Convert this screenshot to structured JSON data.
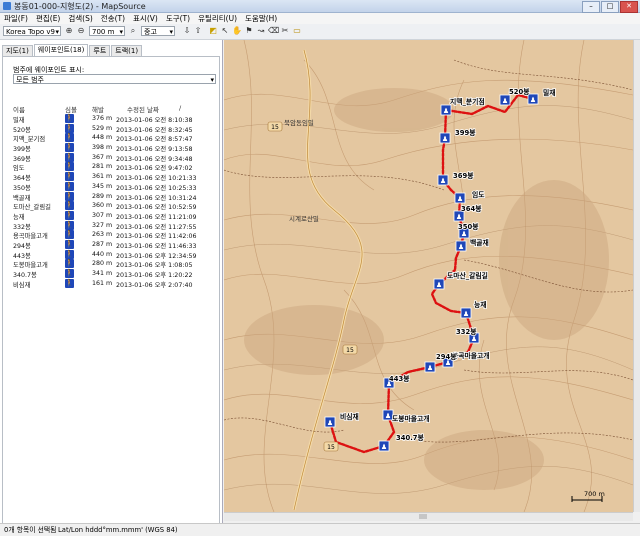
{
  "window": {
    "title": "봉동01-000-지형도(2) - MapSource"
  },
  "menu": [
    "파일(F)",
    "편집(E)",
    "검색(S)",
    "전송(T)",
    "표시(V)",
    "도구(T)",
    "유틸리티(U)",
    "도움말(H)"
  ],
  "toolbar": {
    "map_product": "Korea Topo v9",
    "zoom_level": "700 m",
    "detail": "중고"
  },
  "tabs": [
    "지도(1)",
    "웨이포인트(18)",
    "루트",
    "트랙(1)"
  ],
  "filter": {
    "label": "범주에 웨이포인트 표시:",
    "value": "모든 범주"
  },
  "table": {
    "headers": {
      "name": "이름",
      "symbol": "심볼",
      "altitude": "해발",
      "modified": "수정된 날짜"
    },
    "rows": [
      {
        "name": "밀재",
        "alt": "376 m",
        "date": "2013-01-06 오전 8:10:38"
      },
      {
        "name": "520봉",
        "alt": "529 m",
        "date": "2013-01-06 오전 8:32:45"
      },
      {
        "name": "지맥_분기점",
        "alt": "448 m",
        "date": "2013-01-06 오전 8:57:47"
      },
      {
        "name": "399봉",
        "alt": "398 m",
        "date": "2013-01-06 오전 9:13:58"
      },
      {
        "name": "369봉",
        "alt": "367 m",
        "date": "2013-01-06 오전 9:34:48"
      },
      {
        "name": "임도",
        "alt": "281 m",
        "date": "2013-01-06 오전 9:47:02"
      },
      {
        "name": "364봉",
        "alt": "361 m",
        "date": "2013-01-06 오전 10:21:33"
      },
      {
        "name": "350봉",
        "alt": "345 m",
        "date": "2013-01-06 오전 10:25:33"
      },
      {
        "name": "백골재",
        "alt": "289 m",
        "date": "2013-01-06 오전 10:31:24"
      },
      {
        "name": "도마산_갈림길",
        "alt": "360 m",
        "date": "2013-01-06 오전 10:52:59"
      },
      {
        "name": "능재",
        "alt": "307 m",
        "date": "2013-01-06 오전 11:21:09"
      },
      {
        "name": "332봉",
        "alt": "327 m",
        "date": "2013-01-06 오전 11:27:55"
      },
      {
        "name": "용곡마을고개",
        "alt": "263 m",
        "date": "2013-01-06 오전 11:42:06"
      },
      {
        "name": "294봉",
        "alt": "287 m",
        "date": "2013-01-06 오전 11:46:33"
      },
      {
        "name": "443봉",
        "alt": "440 m",
        "date": "2013-01-06 오후 12:34:59"
      },
      {
        "name": "도봉마을고개",
        "alt": "280 m",
        "date": "2013-01-06 오후 1:08:05"
      },
      {
        "name": "340.7봉",
        "alt": "341 m",
        "date": "2013-01-06 오후 1:20:22"
      },
      {
        "name": "비심재",
        "alt": "161 m",
        "date": "2013-01-06 오후 2:07:40"
      }
    ]
  },
  "map": {
    "labels": [
      "520봉",
      "밀재",
      "지맥_분기점",
      "399봉",
      "369봉",
      "임도",
      "364봉",
      "350봉",
      "백골재",
      "도마산_갈림길",
      "능재",
      "332봉",
      "용곡마을고개",
      "294봉",
      "443봉",
      "도봉마을고개",
      "340.7봉",
      "비심재",
      "북암동임밀",
      "시계로산밀",
      "15",
      "15",
      "15",
      "700 m"
    ]
  },
  "status": {
    "selection": "0개 항목이 선택됨",
    "coord_format": "Lat/Lon hddd°mm.mmm' (WGS 84)"
  }
}
